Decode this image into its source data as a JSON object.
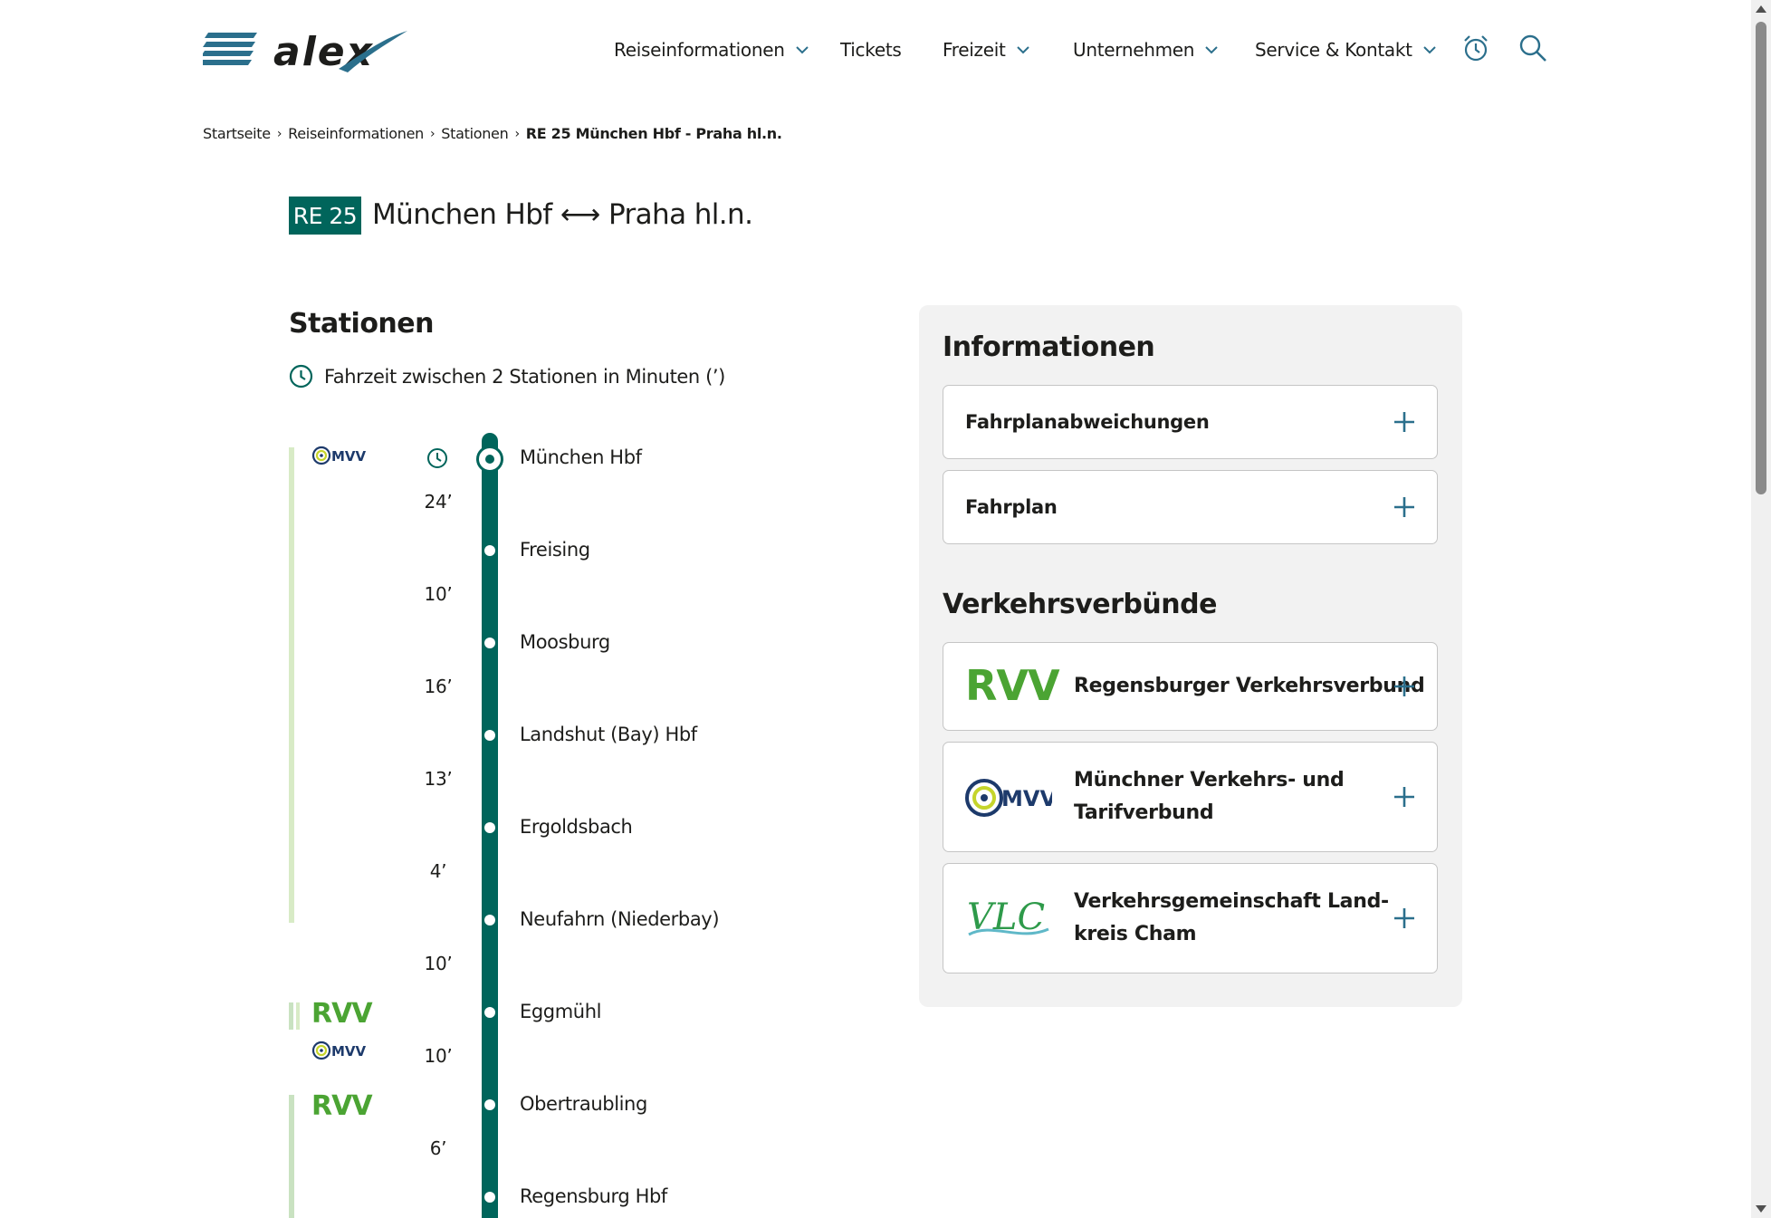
{
  "header": {
    "logo_text": "alex",
    "nav": [
      {
        "label": "Reiseinformationen",
        "has_dropdown": true
      },
      {
        "label": "Tickets",
        "has_dropdown": false
      },
      {
        "label": "Freizeit",
        "has_dropdown": true
      },
      {
        "label": "Unternehmen",
        "has_dropdown": true
      },
      {
        "label": "Service & Kontakt",
        "has_dropdown": true
      }
    ],
    "icons": [
      "alarm-clock-icon",
      "search-icon"
    ]
  },
  "breadcrumb": [
    "Startseite",
    "Reiseinformationen",
    "Stationen",
    "RE 25 München Hbf - Praha hl.n."
  ],
  "route": {
    "line": "RE 25",
    "title": "München Hbf ⟷ Praha hl.n."
  },
  "stations_section": {
    "heading": "Stationen",
    "legend": "Fahrzeit zwischen 2 Stationen in Minuten (’)",
    "stations": [
      "München Hbf",
      "Freising",
      "Moosburg",
      "Landshut (Bay) Hbf",
      "Ergoldsbach",
      "Neufahrn (Niederbay)",
      "Eggmühl",
      "Obertraubling",
      "Regensburg Hbf"
    ],
    "durations": [
      "24’",
      "10’",
      "16’",
      "13’",
      "4’",
      "10’",
      "10’",
      "6’"
    ],
    "verbund_labels": {
      "mvv": "MVV",
      "rvv": "RVV"
    }
  },
  "info_panel": {
    "heading": "Informationen",
    "accordions": [
      "Fahrplanabweichungen",
      "Fahrplan"
    ],
    "verbuende_heading": "Verkehrsverbünde",
    "verbuende": [
      {
        "logo": "RVV",
        "name": "Regensburger Verkehrsverbund"
      },
      {
        "logo": "MVV",
        "name_line1": "Münchner Verkehrs- und",
        "name_line2": "Tarifverbund"
      },
      {
        "logo": "VLC",
        "name_line1": "Verkehrsgemeinschaft Land-",
        "name_line2": "kreis Cham"
      }
    ]
  },
  "colors": {
    "brand_green": "#00655b",
    "accent_blue": "#2b6f8c",
    "rvv_green": "#4ba433",
    "panel_bg": "#f2f2f2"
  }
}
